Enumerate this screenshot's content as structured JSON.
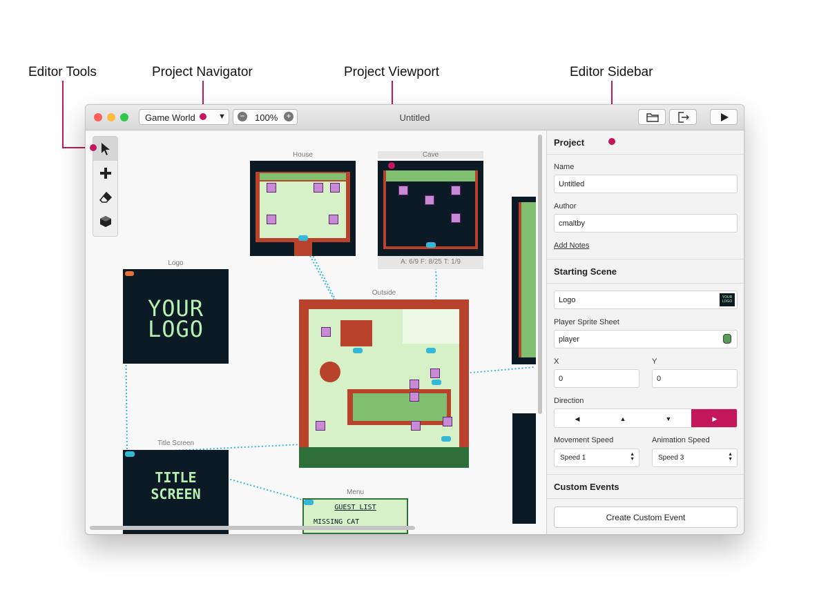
{
  "callouts": {
    "editor_tools": "Editor Tools",
    "project_navigator": "Project Navigator",
    "project_viewport": "Project Viewport",
    "editor_sidebar": "Editor Sidebar"
  },
  "window": {
    "title": "Untitled",
    "navigator_value": "Game World",
    "zoom": "100%"
  },
  "scenes": {
    "house": "House",
    "cave": "Cave",
    "cave_stats": "A: 6/9   F: 8/25   T: 1/9",
    "logo": "Logo",
    "logo_line1": "YOUR",
    "logo_line2": "LOGO",
    "outside": "Outside",
    "title_screen": "Title Screen",
    "title_line1": "TITLE",
    "title_line2": "SCREEN",
    "menu": "Menu",
    "menu_title": "GUEST LIST",
    "menu_item": "MISSING CAT"
  },
  "sidebar": {
    "project_heading": "Project",
    "name_label": "Name",
    "name_value": "Untitled",
    "author_label": "Author",
    "author_value": "cmaltby",
    "add_notes": "Add Notes",
    "starting_scene_heading": "Starting Scene",
    "starting_scene_value": "Logo",
    "scene_thumb_text": "YOUR LOGO",
    "sprite_sheet_label": "Player Sprite Sheet",
    "sprite_sheet_value": "player",
    "x_label": "X",
    "x_value": "0",
    "y_label": "Y",
    "y_value": "0",
    "direction_label": "Direction",
    "movement_speed_label": "Movement Speed",
    "movement_speed_value": "Speed 1",
    "animation_speed_label": "Animation Speed",
    "animation_speed_value": "Speed 3",
    "custom_events_heading": "Custom Events",
    "create_custom_event": "Create Custom Event"
  },
  "colors": {
    "accent": "#c2185b",
    "trigger": "#35b8d8",
    "scene_bg": "#0b1a24",
    "scene_text": "#b8f0b0",
    "grass": "#d6f0c8",
    "wall": "#b8432a"
  },
  "icons": {
    "tools": [
      "select-arrow-icon",
      "add-plus-icon",
      "eraser-icon",
      "colorize-cube-icon"
    ],
    "toolbar": [
      "folder-open-icon",
      "export-icon",
      "play-icon"
    ]
  }
}
